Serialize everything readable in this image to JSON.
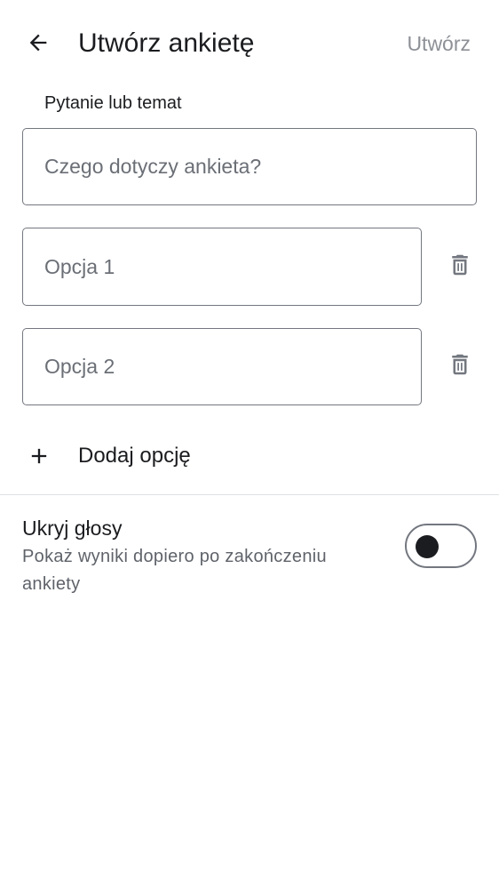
{
  "header": {
    "back_icon": "arrow-left-icon",
    "title": "Utwórz ankietę",
    "create_label": "Utwórz"
  },
  "question": {
    "label": "Pytanie lub temat",
    "value": "",
    "placeholder": "Czego dotyczy ankieta?"
  },
  "options": [
    {
      "value": "",
      "placeholder": "Opcja 1",
      "delete_icon": "trash-icon"
    },
    {
      "value": "",
      "placeholder": "Opcja 2",
      "delete_icon": "trash-icon"
    }
  ],
  "add_option": {
    "icon": "plus-icon",
    "label": "Dodaj opcję"
  },
  "hide_votes": {
    "title": "Ukryj głosy",
    "description": "Pokaż wyniki dopiero po zakończeniu ankiety",
    "enabled": false
  },
  "colors": {
    "text_primary": "#1b1c1f",
    "text_secondary": "#5f636a",
    "disabled_action": "#8d9096",
    "outline": "#73777f",
    "divider": "#dfe1e5"
  }
}
